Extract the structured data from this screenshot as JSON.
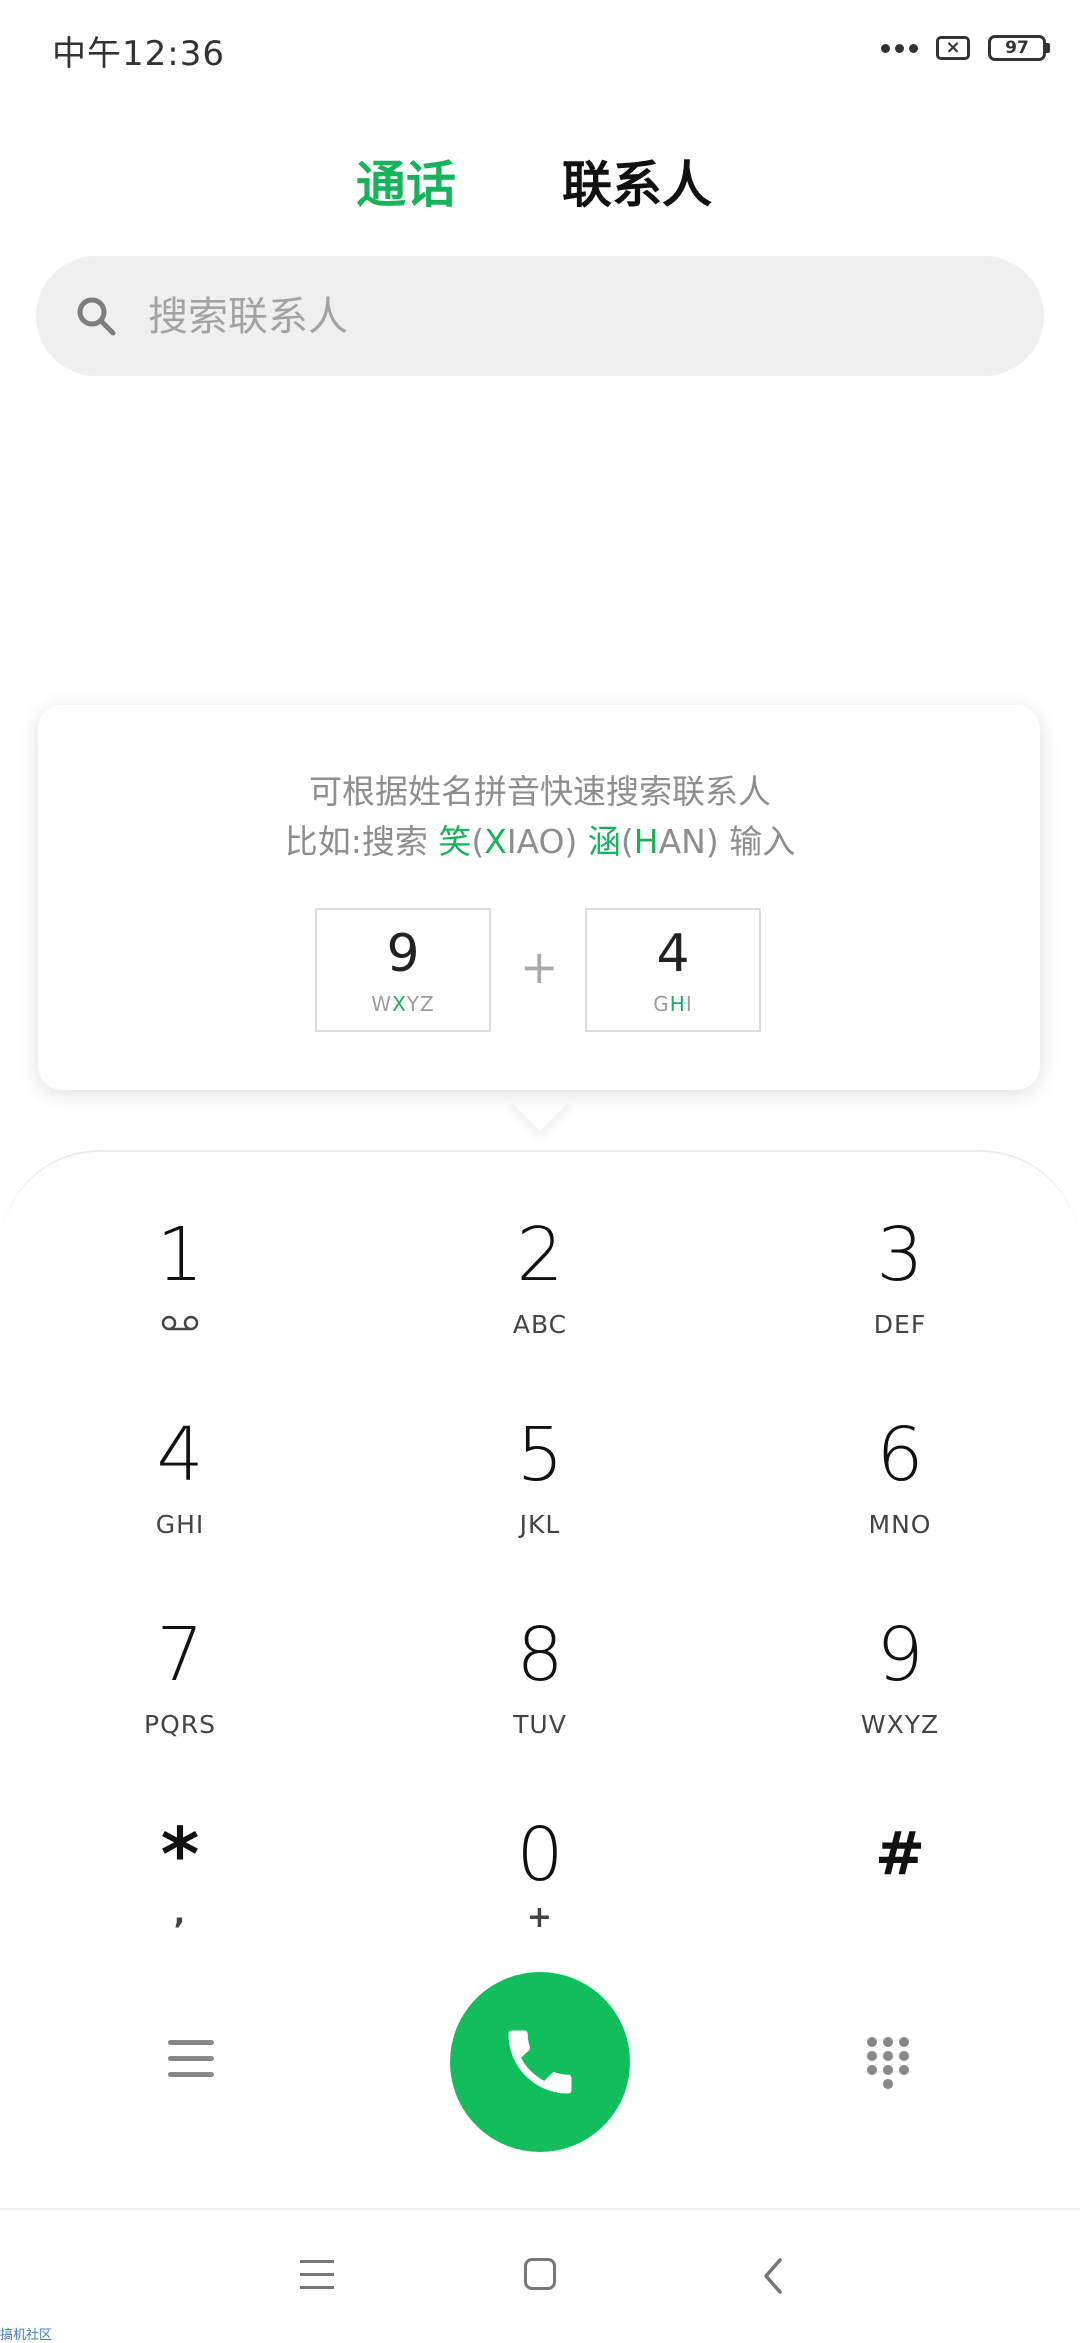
{
  "status_bar": {
    "time": "中午12:36",
    "battery": "97"
  },
  "tabs": {
    "calls": "通话",
    "contacts": "联系人"
  },
  "search": {
    "placeholder": "搜索联系人"
  },
  "hint": {
    "line1": "可根据姓名拼音快速搜索联系人",
    "line2_prefix": "比如:搜索 ",
    "char1": "笑",
    "paren_open": "(",
    "initial1": "X",
    "rest1": "IAO",
    "paren_close": ") ",
    "char2": "涵",
    "initial2": "H",
    "rest2": "AN",
    "suffix": ") 输入",
    "example_keys": [
      {
        "number": "9",
        "letters_pre": "W",
        "letters_hl": "X",
        "letters_post": "YZ"
      },
      {
        "number": "4",
        "letters_pre": "G",
        "letters_hl": "H",
        "letters_post": "I"
      }
    ],
    "plus": "+"
  },
  "dialpad": {
    "keys": [
      {
        "number": "1",
        "letters": ""
      },
      {
        "number": "2",
        "letters": "ABC"
      },
      {
        "number": "3",
        "letters": "DEF"
      },
      {
        "number": "4",
        "letters": "GHI"
      },
      {
        "number": "5",
        "letters": "JKL"
      },
      {
        "number": "6",
        "letters": "MNO"
      },
      {
        "number": "7",
        "letters": "PQRS"
      },
      {
        "number": "8",
        "letters": "TUV"
      },
      {
        "number": "9",
        "letters": "WXYZ"
      },
      {
        "number": "*",
        "letters": ","
      },
      {
        "number": "0",
        "letters": "+"
      },
      {
        "number": "#",
        "letters": ""
      }
    ]
  },
  "colors": {
    "accent": "#17b35b",
    "call_button": "#12bd5c"
  },
  "icons": {
    "search": "search-icon",
    "call": "phone-icon",
    "menu": "menu-icon",
    "dialpad": "dialpad-icon",
    "voicemail": "voicemail-icon"
  },
  "watermark": "搞机社区"
}
